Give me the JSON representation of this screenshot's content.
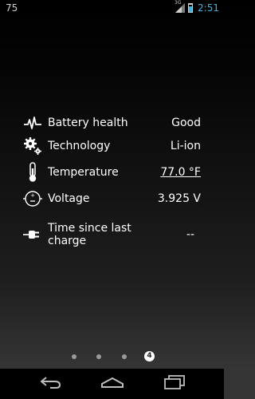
{
  "status_bar": {
    "left_text": "75",
    "network_label": "3G",
    "time": "2:51",
    "battery_level": 0.75,
    "accent_color": "#33b5e5"
  },
  "rows": [
    {
      "icon": "pulse-icon",
      "label": "Battery health",
      "value": "Good"
    },
    {
      "icon": "gears-icon",
      "label": "Technology",
      "value": "Li-ion"
    },
    {
      "icon": "thermometer-icon",
      "label": "Temperature",
      "value": "77.0 °F"
    },
    {
      "icon": "voltage-icon",
      "label": "Voltage",
      "value": "3.925 V"
    },
    {
      "icon": "plug-icon",
      "label": "Time since last charge",
      "value": "--"
    }
  ],
  "pager": {
    "page_count": 4,
    "active_page_label": "4"
  },
  "nav_bar": {
    "icons": [
      "back-icon",
      "home-icon",
      "recents-icon"
    ]
  }
}
